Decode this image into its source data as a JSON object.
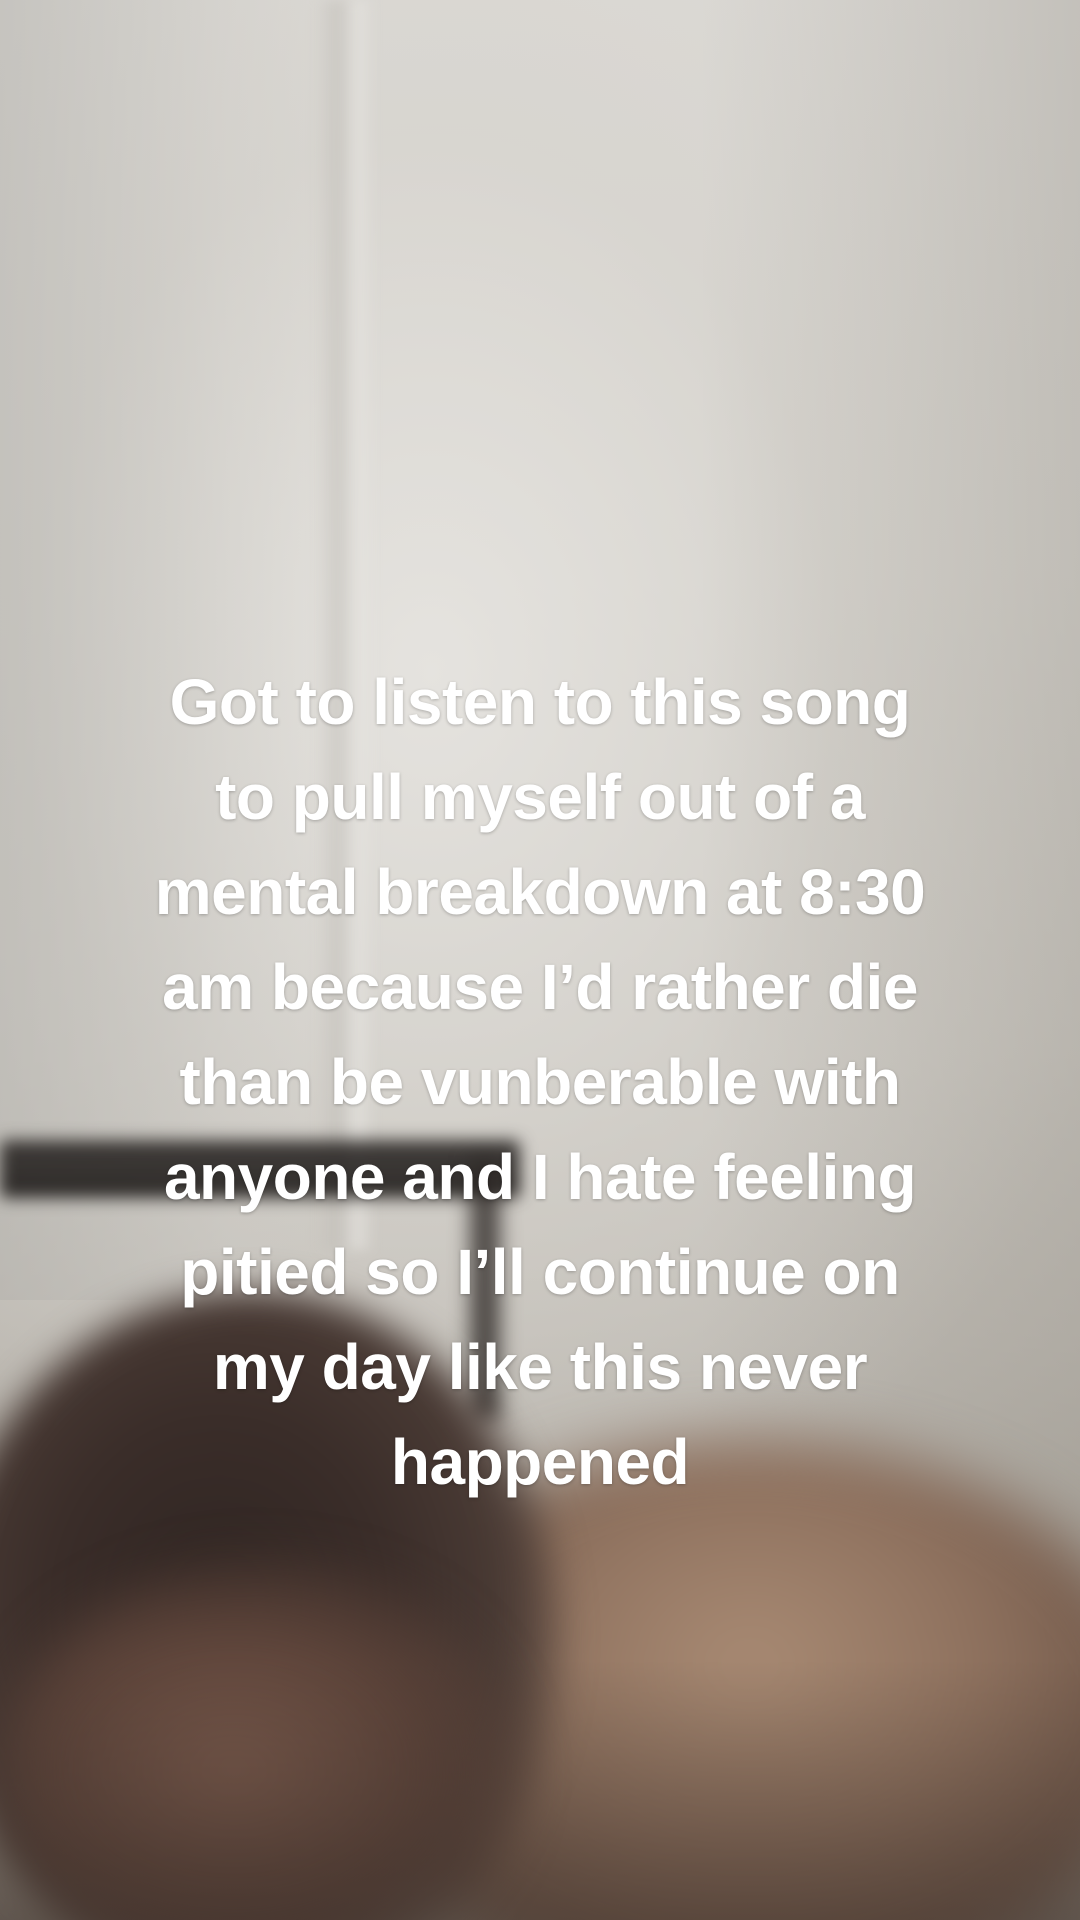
{
  "caption": {
    "lines": [
      "Got to listen to this song",
      "to pull myself out of a",
      "mental breakdown at 8:30",
      "am because I’d rather die",
      "than be vunberable with",
      "anyone and I hate feeling",
      "pitied so I’ll continue on",
      "my day like this never",
      "happened"
    ]
  },
  "colors": {
    "caption_text": "#ffffff",
    "wall": "#d7d5d0",
    "headboard": "#2a2523",
    "hair": "#2f2522"
  }
}
